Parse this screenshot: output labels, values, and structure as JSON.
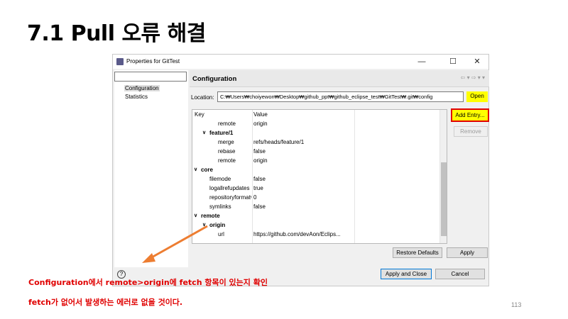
{
  "slide": {
    "title": "7.1 Pull 오류 해결",
    "note_line1": "Configuration에서 remote>origin에 fetch 항목이 있는지 확인",
    "note_line2": "fetch가 없어서 발생하는 에러로 없을 것이다.",
    "page_number": "113",
    "note_color": "#e00000",
    "highlight_color": "#ffff00",
    "arrow_color": "#ed7d31"
  },
  "window": {
    "title": "Properties for GitTest",
    "minimize_icon": "—",
    "maximize_icon": "☐",
    "close_icon": "✕"
  },
  "nav": {
    "items": [
      {
        "label": "Configuration",
        "selected": true
      },
      {
        "label": "Statistics",
        "selected": false
      }
    ]
  },
  "config": {
    "header": "Configuration",
    "history_nav": "⇦ ▾ ⇨ ▾ ▾",
    "location_label": "Location:",
    "location_value": "C:₩Users₩choiyewon₩Desktop₩github_ppt₩github_eclipse_test₩GitTest₩.git₩config",
    "open_label": "Open",
    "add_entry_label": "Add Entry...",
    "remove_label": "Remove",
    "table": {
      "col_key": "Key",
      "col_value": "Value",
      "rows": [
        {
          "key": "remote",
          "value": "origin",
          "level": 3,
          "toggle": ""
        },
        {
          "key": "feature/1",
          "value": "",
          "level": 1,
          "toggle": "∨"
        },
        {
          "key": "merge",
          "value": "refs/heads/feature/1",
          "level": 3,
          "toggle": ""
        },
        {
          "key": "rebase",
          "value": "false",
          "level": 3,
          "toggle": ""
        },
        {
          "key": "remote",
          "value": "origin",
          "level": 3,
          "toggle": ""
        },
        {
          "key": "core",
          "value": "",
          "level": 0,
          "toggle": "∨"
        },
        {
          "key": "filemode",
          "value": "false",
          "level": 2,
          "toggle": ""
        },
        {
          "key": "logallrefupdates",
          "value": "true",
          "level": 2,
          "toggle": ""
        },
        {
          "key": "repositoryformatversion",
          "value": "0",
          "level": 2,
          "toggle": ""
        },
        {
          "key": "symlinks",
          "value": "false",
          "level": 2,
          "toggle": ""
        },
        {
          "key": "remote",
          "value": "",
          "level": 0,
          "toggle": "∨"
        },
        {
          "key": "origin",
          "value": "",
          "level": 1,
          "toggle": "∨"
        },
        {
          "key": "url",
          "value": "https://github.com/devAon/Eclips...",
          "level": 3,
          "toggle": ""
        }
      ]
    },
    "restore_defaults_label": "Restore Defaults",
    "apply_label": "Apply"
  },
  "footer": {
    "help_icon": "?",
    "apply_close_label": "Apply and Close",
    "cancel_label": "Cancel"
  }
}
